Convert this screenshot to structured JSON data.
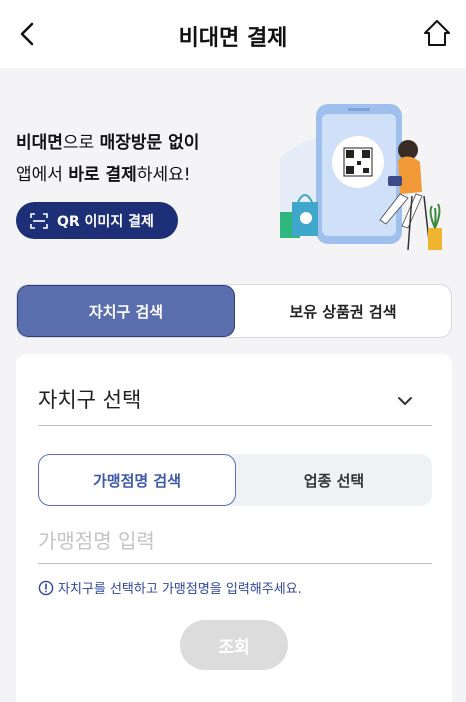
{
  "header": {
    "title": "비대면 결제"
  },
  "promo": {
    "line1": [
      {
        "text": "비대면",
        "bold": true
      },
      {
        "text": "으로 ",
        "bold": false
      },
      {
        "text": "매장방문 없이",
        "bold": true
      }
    ],
    "line2": [
      {
        "text": "앱에서 ",
        "bold": false
      },
      {
        "text": "바로 결제",
        "bold": true
      },
      {
        "text": "하세요!",
        "bold": false
      }
    ],
    "qr_button_label": "QR 이미지 결제"
  },
  "tabs": {
    "items": [
      {
        "label": "자치구 검색",
        "active": true
      },
      {
        "label": "보유 상품권 검색",
        "active": false
      }
    ]
  },
  "form": {
    "district_label": "자치구 선택",
    "sub_tabs": [
      {
        "label": "가맹점명 검색",
        "active": true
      },
      {
        "label": "업종 선택",
        "active": false
      }
    ],
    "store_placeholder": "가맹점명 입력",
    "store_value": "",
    "hint": "자치구를 선택하고 가맹점명을 입력해주세요.",
    "search_label": "조회"
  },
  "colors": {
    "brand_navy": "#1c2f77",
    "tab_active": "#5a6eae",
    "accent_blue": "#5472c4",
    "disabled_button": "#dcdcdc"
  }
}
